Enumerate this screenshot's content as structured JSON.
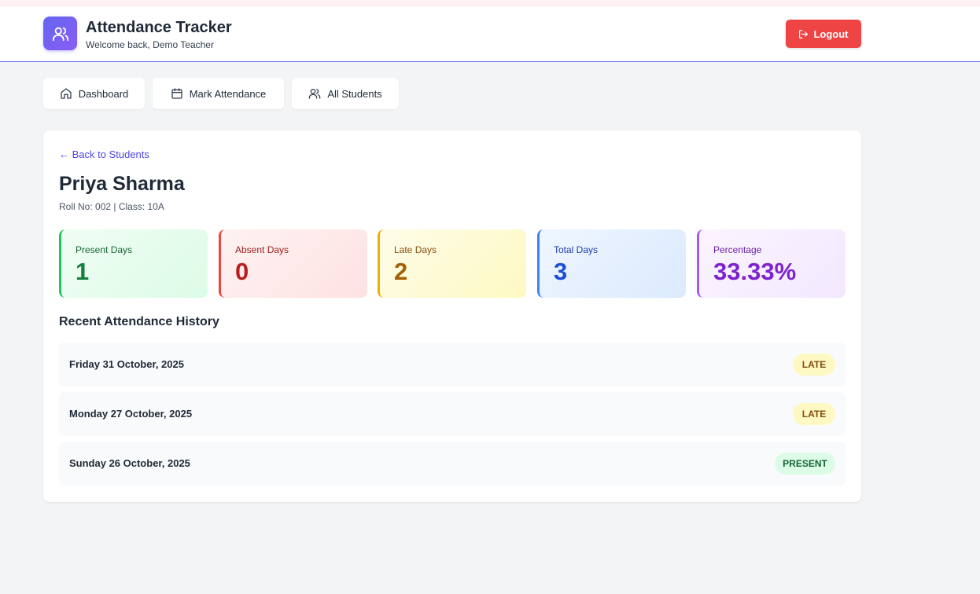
{
  "header": {
    "title": "Attendance Tracker",
    "subtitle": "Welcome back, Demo Teacher",
    "logout_label": "Logout"
  },
  "nav": [
    {
      "label": "Dashboard",
      "icon": "home-icon"
    },
    {
      "label": "Mark Attendance",
      "icon": "calendar-icon"
    },
    {
      "label": "All Students",
      "icon": "users-icon"
    }
  ],
  "student": {
    "back_link": "← Back to Students",
    "name": "Priya Sharma",
    "meta": "Roll No: 002 | Class: 10A"
  },
  "stats": {
    "present": {
      "label": "Present Days",
      "value": "1"
    },
    "absent": {
      "label": "Absent Days",
      "value": "0"
    },
    "late": {
      "label": "Late Days",
      "value": "2"
    },
    "total": {
      "label": "Total Days",
      "value": "3"
    },
    "percentage": {
      "label": "Percentage",
      "value": "33.33%"
    }
  },
  "history": {
    "title": "Recent Attendance History",
    "rows": [
      {
        "date": "Friday 31 October, 2025",
        "status": "LATE"
      },
      {
        "date": "Monday 27 October, 2025",
        "status": "LATE"
      },
      {
        "date": "Sunday 26 October, 2025",
        "status": "PRESENT"
      }
    ]
  },
  "colors": {
    "accent": "#6366f1",
    "logout": "#ef4444",
    "present": "#22c55e",
    "absent": "#ef4444",
    "late": "#eab308",
    "total": "#3b82f6",
    "percentage": "#a855f7"
  }
}
